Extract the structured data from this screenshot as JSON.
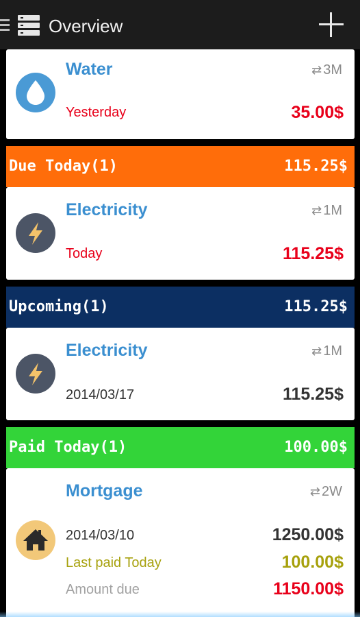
{
  "actionbar": {
    "title": "Overview",
    "drawer_icon": "menu-icon",
    "app_icon": "list-icon",
    "add_icon": "plus-icon"
  },
  "bills": [
    {
      "name": "Water",
      "recurrence": "3M",
      "date": "Yesterday",
      "amount": "35.00$",
      "icon": "water-drop-icon",
      "icon_bg": "#4a9ad5"
    },
    {
      "name": "Electricity",
      "recurrence": "1M",
      "date": "Today",
      "amount": "115.25$",
      "icon": "lightning-icon",
      "icon_bg": "#4c5566"
    },
    {
      "name": "Electricity",
      "recurrence": "1M",
      "date": "2014/03/17",
      "amount": "115.25$",
      "icon": "lightning-icon",
      "icon_bg": "#4c5566"
    },
    {
      "name": "Mortgage",
      "recurrence": "2W",
      "date": "2014/03/10",
      "amount": "1250.00$",
      "last_paid_label": "Last paid Today",
      "last_paid_amount": "100.00$",
      "amount_due_label": "Amount due",
      "amount_due": "1150.00$",
      "icon": "house-icon",
      "icon_bg": "#f2c879"
    }
  ],
  "sections": [
    {
      "label": "Due Today(1)",
      "total": "115.25$",
      "color": "#ff6d0a"
    },
    {
      "label": "Upcoming(1)",
      "total": "115.25$",
      "color": "#0c2f62"
    },
    {
      "label": "Paid Today(1)",
      "total": "100.00$",
      "color": "#33d439"
    }
  ],
  "colors": {
    "bill_name": "#3b8fd0",
    "overdue_red": "#e8001a",
    "paid_olive": "#a7a10d"
  }
}
